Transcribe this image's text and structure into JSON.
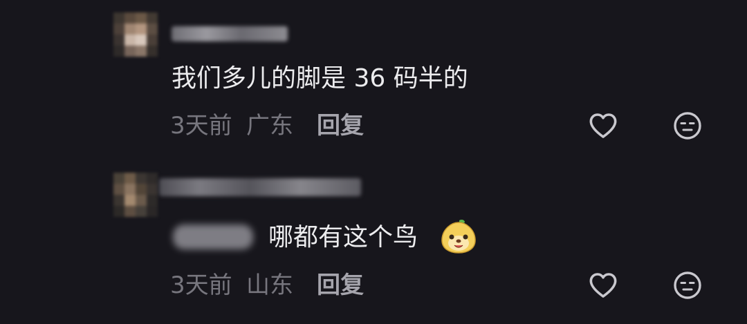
{
  "comments": [
    {
      "text": "我们多儿的脚是 36 码半的",
      "time": "3天前",
      "location": "广东",
      "reply_label": "回复"
    },
    {
      "text": "哪都有这个鸟",
      "time": "3天前",
      "location": "山东",
      "reply_label": "回复"
    }
  ],
  "icons": {
    "like": "heart-outline-icon",
    "dislike": "neutral-face-icon",
    "sticker": "cartoon-pear-face-emoji"
  },
  "colors": {
    "background": "#17161c",
    "primary_text": "#ececee",
    "secondary_text": "#77767e",
    "reply_text": "#a6a5ad",
    "icon": "#c9c8ce"
  }
}
